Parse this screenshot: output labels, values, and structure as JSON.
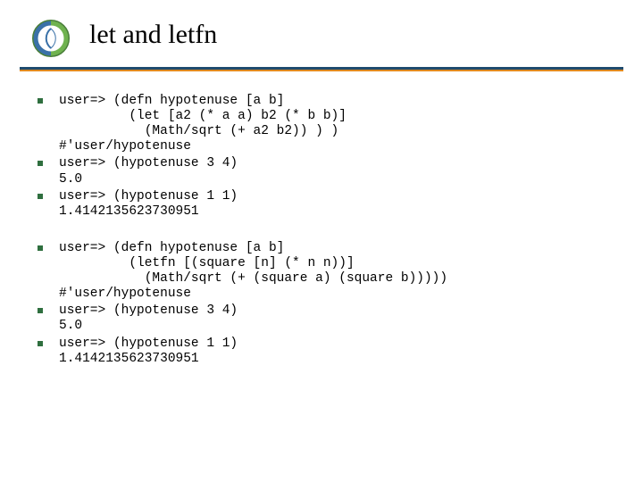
{
  "title": "let and letfn",
  "blocks": [
    {
      "type": "item",
      "text": "user=> (defn hypotenuse [a b]\n         (let [a2 (* a a) b2 (* b b)]\n           (Math/sqrt (+ a2 b2)) ) )\n#'user/hypotenuse"
    },
    {
      "type": "item",
      "text": "user=> (hypotenuse 3 4)\n5.0"
    },
    {
      "type": "item",
      "text": "user=> (hypotenuse 1 1)\n1.4142135623730951"
    },
    {
      "type": "gap"
    },
    {
      "type": "item",
      "text": "user=> (defn hypotenuse [a b]\n         (letfn [(square [n] (* n n))]\n           (Math/sqrt (+ (square a) (square b)))))\n#'user/hypotenuse"
    },
    {
      "type": "item",
      "text": "user=> (hypotenuse 3 4)\n5.0"
    },
    {
      "type": "item",
      "text": "user=> (hypotenuse 1 1)\n1.4142135623730951"
    }
  ]
}
